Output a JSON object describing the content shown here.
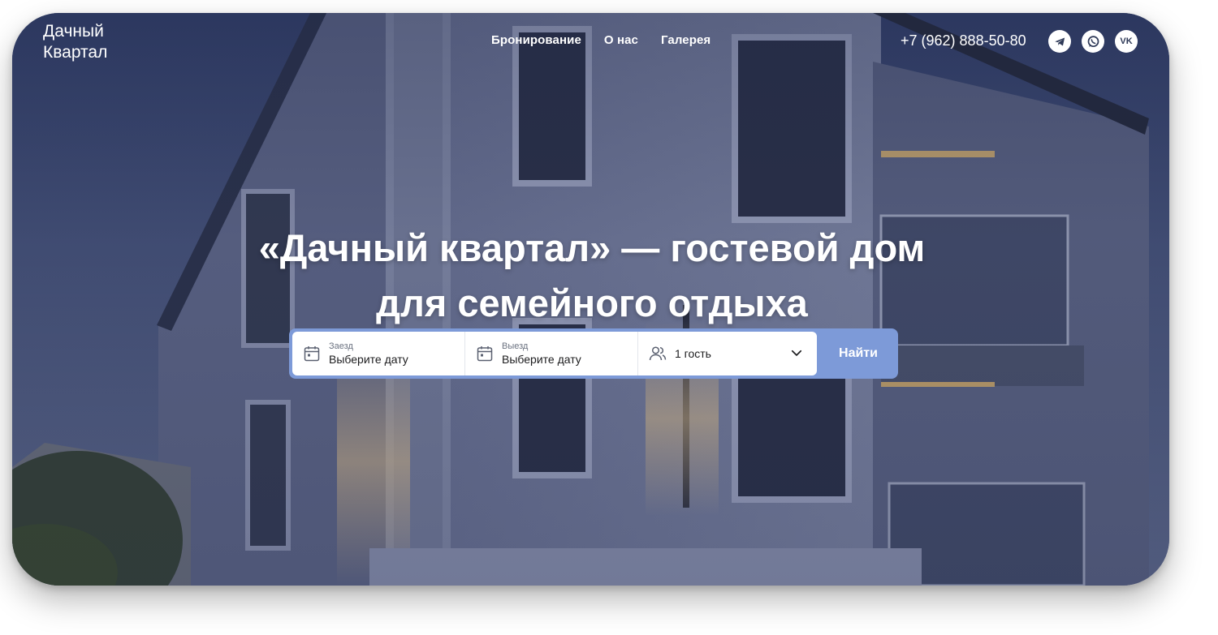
{
  "brand": {
    "line1": "Дачный",
    "line2": "Квартал"
  },
  "nav": [
    {
      "label": "Бронирование"
    },
    {
      "label": "О нас"
    },
    {
      "label": "Галерея"
    }
  ],
  "contact": {
    "phone": "+7 (962) 888-50-80"
  },
  "socials": [
    {
      "icon": "telegram-icon"
    },
    {
      "icon": "whatsapp-icon"
    },
    {
      "icon": "vk-icon",
      "text": "VK"
    }
  ],
  "hero": {
    "title": "«Дачный квартал» — гостевой дом для семейного отдыха"
  },
  "booking": {
    "checkin": {
      "label": "Заезд",
      "value": "Выберите дату",
      "icon": "calendar-icon"
    },
    "checkout": {
      "label": "Выезд",
      "value": "Выберите дату",
      "icon": "calendar-icon"
    },
    "guests": {
      "value": "1 гость",
      "icon": "users-icon",
      "dropdown_icon": "chevron-down-icon"
    },
    "search_label": "Найти"
  },
  "colors": {
    "accent": "#7d9ad8",
    "text_light": "#ffffff",
    "sky": "#3f4b6c"
  }
}
